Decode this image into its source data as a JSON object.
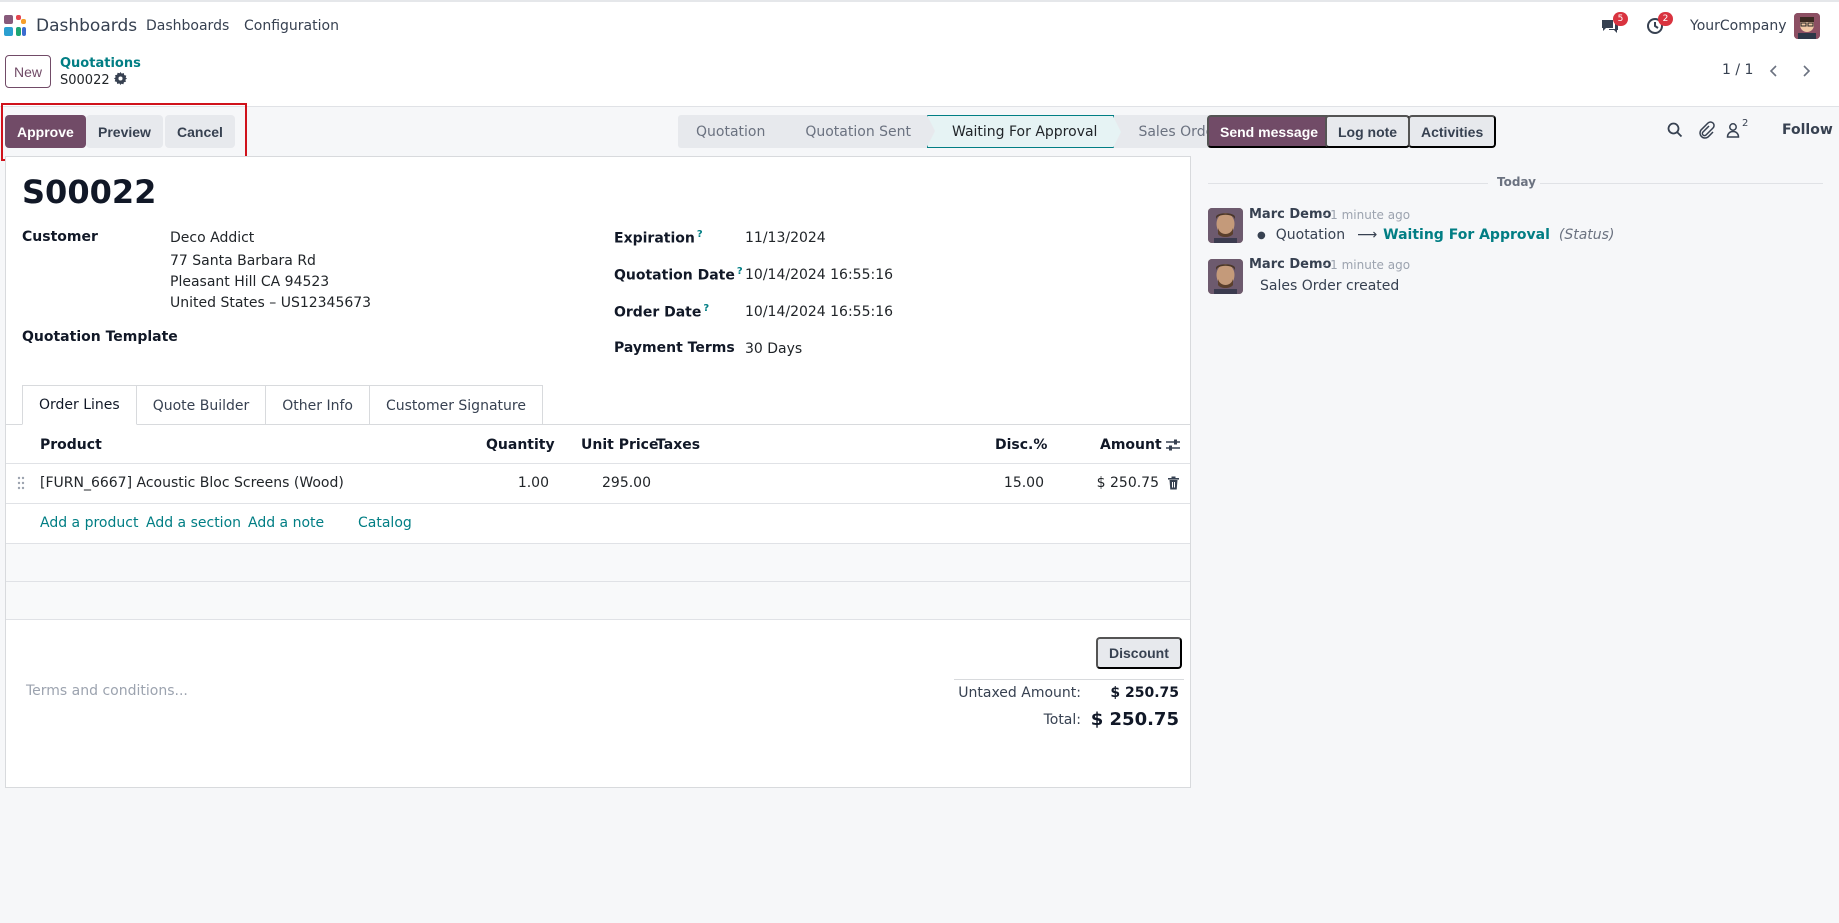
{
  "navbar": {
    "brand": "Dashboards",
    "menu": [
      "Dashboards",
      "Configuration"
    ],
    "messages_count": "5",
    "activities_count": "2",
    "company": "YourCompany"
  },
  "control": {
    "new_label": "New",
    "breadcrumb_parent": "Quotations",
    "breadcrumb_current": "S00022",
    "pager": "1 / 1"
  },
  "actions": {
    "approve": "Approve",
    "preview": "Preview",
    "cancel": "Cancel"
  },
  "statusbar": {
    "stages": [
      "Quotation",
      "Quotation Sent",
      "Waiting For Approval",
      "Sales Order"
    ],
    "active_index": 2
  },
  "form": {
    "name": "S00022",
    "customer_label": "Customer",
    "customer_name": "Deco Addict",
    "address_line1": "77 Santa Barbara Rd",
    "address_line2": "Pleasant Hill CA 94523",
    "address_line3": "United States – US12345673",
    "template_label": "Quotation Template",
    "expiration_label": "Expiration",
    "expiration": "11/13/2024",
    "quotation_date_label": "Quotation Date",
    "quotation_date": "10/14/2024 16:55:16",
    "order_date_label": "Order Date",
    "order_date": "10/14/2024 16:55:16",
    "payment_terms_label": "Payment Terms",
    "payment_terms": "30 Days",
    "help_mark": "?"
  },
  "tabs": [
    "Order Lines",
    "Quote Builder",
    "Other Info",
    "Customer Signature"
  ],
  "order_lines": {
    "headers": {
      "product": "Product",
      "quantity": "Quantity",
      "unit_price": "Unit Price",
      "taxes": "Taxes",
      "discount": "Disc.%",
      "amount": "Amount"
    },
    "rows": [
      {
        "product": "[FURN_6667] Acoustic Bloc Screens (Wood)",
        "quantity": "1.00",
        "unit_price": "295.00",
        "taxes": "",
        "discount": "15.00",
        "amount": "$ 250.75"
      }
    ],
    "add_product": "Add a product",
    "add_section": "Add a section",
    "add_note": "Add a note",
    "catalog": "Catalog"
  },
  "totals": {
    "discount_button": "Discount",
    "terms_placeholder": "Terms and conditions...",
    "untaxed_label": "Untaxed Amount:",
    "untaxed_value": "$ 250.75",
    "total_label": "Total:",
    "total_value": "$ 250.75"
  },
  "chatter": {
    "send_message": "Send message",
    "log_note": "Log note",
    "activities": "Activities",
    "followers_count": "2",
    "follow": "Follow",
    "today": "Today",
    "messages": [
      {
        "author": "Marc Demo",
        "time": "- 1 minute ago",
        "old_value": "Quotation",
        "arrow": "⟶",
        "new_value": "Waiting For Approval",
        "field": "(Status)"
      },
      {
        "author": "Marc Demo",
        "time": "- 1 minute ago",
        "body": "Sales Order created"
      }
    ]
  },
  "colors": {
    "brand": "#714b67",
    "link": "#017e84",
    "highlight": "#d0121b"
  }
}
